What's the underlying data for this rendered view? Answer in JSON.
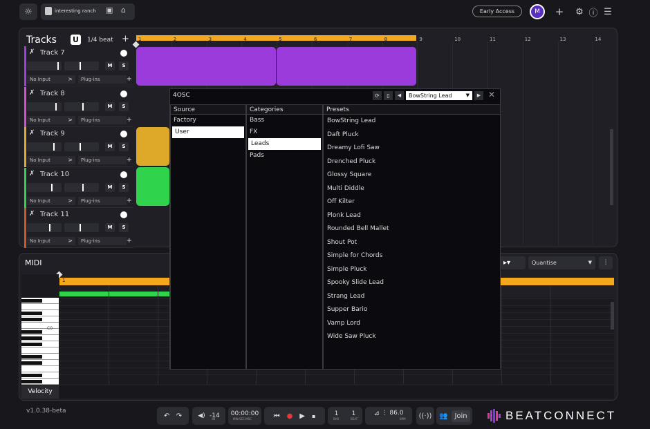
{
  "header": {
    "project_name": "interesting ranch",
    "early_access": "Early Access",
    "avatar_initial": "M"
  },
  "tracks_panel": {
    "title": "Tracks",
    "quantize": "1/4 beat",
    "add": "+"
  },
  "tracks": [
    {
      "name": "Track 7",
      "color": "#a13ee0",
      "input": "No Input",
      "plugins": "Plug-ins",
      "m": "M",
      "s": "S"
    },
    {
      "name": "Track 8",
      "color": "#d94bd6",
      "input": "No Input",
      "plugins": "Plug-ins",
      "m": "M",
      "s": "S"
    },
    {
      "name": "Track 9",
      "color": "#e0a92a",
      "input": "No Input",
      "plugins": "Plug-ins",
      "m": "M",
      "s": "S"
    },
    {
      "name": "Track 10",
      "color": "#2fd44c",
      "input": "No Input",
      "plugins": "Plug-ins",
      "m": "M",
      "s": "S"
    },
    {
      "name": "Track 11",
      "color": "#d2581f",
      "input": "No Input",
      "plugins": "Plug-ins",
      "m": "M",
      "s": "S"
    }
  ],
  "ruler": [
    "1",
    "2",
    "3",
    "4",
    "5",
    "6",
    "7",
    "8",
    "9",
    "10",
    "11",
    "12",
    "13",
    "14"
  ],
  "midi": {
    "title": "MIDI",
    "quantise": "Quantise",
    "velocity": "Velocity",
    "c0": "C0",
    "bar": "1"
  },
  "plugin": {
    "title": "4OSC",
    "preset_selected": "BowString Lead",
    "source_header": "Source",
    "categories_header": "Categories",
    "presets_header": "Presets",
    "sources": [
      "Factory",
      "User"
    ],
    "selected_source": "User",
    "categories": [
      "Bass",
      "FX",
      "Leads",
      "Pads"
    ],
    "selected_category": "Leads",
    "presets": [
      "BowString Lead",
      "Daft Pluck",
      "Dreamy Lofi Saw",
      "Drenched Pluck",
      "Glossy Square",
      "Multi Diddle",
      "Off Kilter",
      "Plonk Lead",
      "Rounded Bell Mallet",
      "Shout Pot",
      "Simple for Chords",
      "Simple Pluck",
      "Spooky Slide Lead",
      "Strang Lead",
      "Supper Bario",
      "Vamp Lord",
      "Wide Saw Pluck"
    ]
  },
  "footer": {
    "version": "v1.0.38-beta",
    "volume": "-14",
    "volume_unit": "dB",
    "time": "00:00:00",
    "time_unit": "MIN:SEC:MSC",
    "bar": "1",
    "bar_label": "BAR",
    "beat": "1",
    "beat_label": "BEAT",
    "bpm": "86.0",
    "bpm_label": "BPM",
    "join": "Join",
    "brand": "BEATCONNECT"
  }
}
